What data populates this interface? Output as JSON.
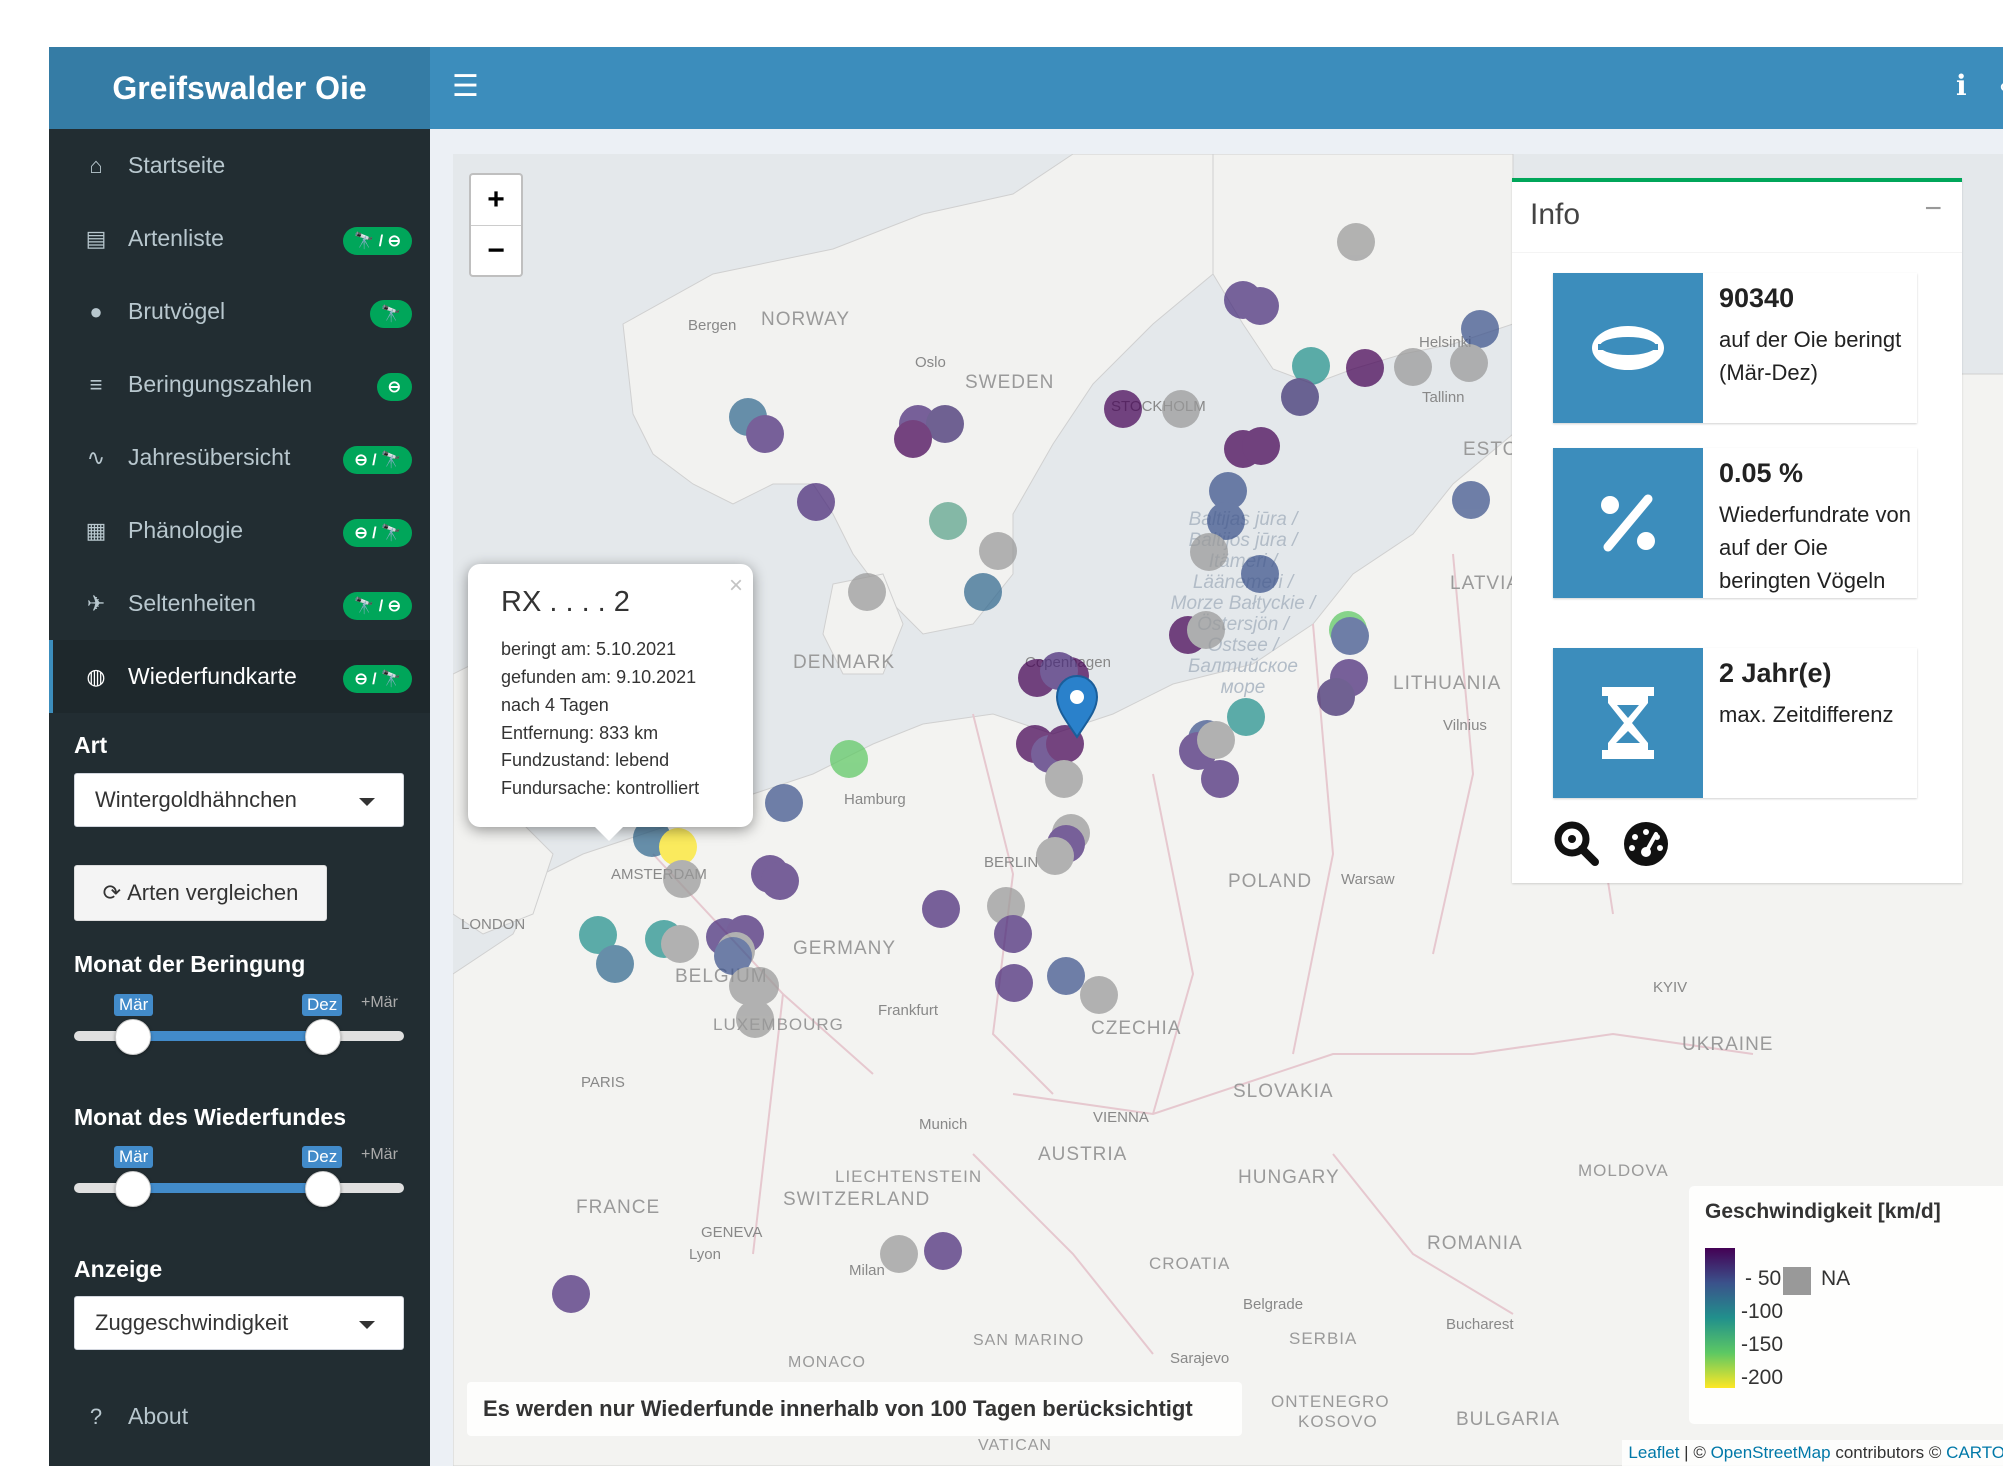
{
  "header": {
    "app_title": "Greifswalder Oie"
  },
  "sidebar": {
    "items": [
      {
        "label": "Startseite",
        "icon": "home-icon"
      },
      {
        "label": "Artenliste",
        "icon": "clipboard-icon",
        "badge": "🔭 / ⊖"
      },
      {
        "label": "Brutvögel",
        "icon": "egg-icon",
        "badge": "🔭"
      },
      {
        "label": "Beringungszahlen",
        "icon": "bar-chart-icon",
        "badge": "⊖"
      },
      {
        "label": "Jahresübersicht",
        "icon": "line-chart-icon",
        "badge": "⊖ / 🔭"
      },
      {
        "label": "Phänologie",
        "icon": "calendar-icon",
        "badge": "⊖ / 🔭"
      },
      {
        "label": "Seltenheiten",
        "icon": "bird-icon",
        "badge": "🔭 / ⊖"
      },
      {
        "label": "Wiederfundkarte",
        "icon": "globe-icon",
        "badge": "⊖ / 🔭",
        "active": true
      }
    ],
    "art_label": "Art",
    "art_value": "Wintergoldhähnchen",
    "compare_button": "Arten vergleichen",
    "ringing_month_label": "Monat der Beringung",
    "recovery_month_label": "Monat des Wiederfundes",
    "slider_from": "Mär",
    "slider_to": "Dez",
    "slider_extra": "+Mär",
    "display_label": "Anzeige",
    "display_value": "Zuggeschwindigkeit",
    "about_label": "About"
  },
  "popup": {
    "title": "RX . . . . 2",
    "close": "×",
    "lines": [
      "beringt am: 5.10.2021",
      "gefunden am: 9.10.2021",
      "nach 4 Tagen",
      "Entfernung: 833 km",
      "Fundzustand: lebend",
      "Fundursache: kontrolliert"
    ]
  },
  "info": {
    "title": "Info",
    "minimize": "−",
    "stats": [
      {
        "value": "90340",
        "text": "auf der Oie beringt (Mär-Dez)",
        "icon": "ring-icon"
      },
      {
        "value": "0.05 %",
        "text": "Wiederfundrate von auf der Oie beringten Vögeln",
        "icon": "percent-icon"
      },
      {
        "value": "2 Jahr(e)",
        "text": "max. Zeitdifferenz",
        "icon": "hourglass-icon"
      }
    ]
  },
  "notice": "Es werden nur Wiederfunde innerhalb von 100 Tagen berücksichtigt",
  "legend": {
    "title": "Geschwindigkeit [km/d]",
    "values": [
      "50",
      "100",
      "150",
      "200"
    ],
    "na_label": "NA"
  },
  "attribution": {
    "leaflet": "Leaflet",
    "sep": " | © ",
    "osm": "OpenStreetMap",
    "mid": " contributors © ",
    "carto": "CARTO"
  },
  "map_labels": {
    "norway": "NORWAY",
    "sweden": "SWEDEN",
    "denmark": "DENMARK",
    "germany": "GERMANY",
    "poland": "POLAND",
    "lithuania": "LITHUANIA",
    "latvia": "LATVIA",
    "esto": "ESTO",
    "belgium": "BELGIUM",
    "luxembourg": "LUXEMBOURG",
    "czechia": "CZECHIA",
    "slovakia": "SLOVAKIA",
    "austria": "AUSTRIA",
    "hungary": "HUNGARY",
    "france": "FRANCE",
    "switzerland": "SWITZERLAND",
    "liechtenstein": "LIECHTENSTEIN",
    "croatia": "CROATIA",
    "romania": "ROMANIA",
    "ukraine": "UKRAINE",
    "moldova": "MOLDOVA",
    "serbia": "SERBIA",
    "bulgaria": "BULGARIA",
    "kosovo": "KOSOVO",
    "montenegro": "ONTENEGRO",
    "san_marino": "SAN MARINO",
    "monaco": "MONACO",
    "vatican": "VATICAN",
    "bergen": "Bergen",
    "oslo": "Oslo",
    "stockholm": "STOCKHOLM",
    "helsinki": "Helsinki",
    "tallinn": "Tallinn",
    "copenhagen": "Copenhagen",
    "hamburg": "Hamburg",
    "berlin": "BERLIN",
    "amsterdam": "AMSTERDAM",
    "london": "LONDON",
    "paris": "PARIS",
    "frankfurt": "Frankfurt",
    "munich": "Munich",
    "vienna": "VIENNA",
    "warsaw": "Warsaw",
    "vilnius": "Vilnius",
    "kyiv": "KYIV",
    "geneva": "GENEVA",
    "lyon": "Lyon",
    "milan": "Milan",
    "belgrade": "Belgrade",
    "bucharest": "Bucharest",
    "sarajevo": "Sarajevo",
    "baltic_sea": "Baltijas jūra / Baltijos jūra / Itämeri / Läänemeri / Morze Bałtyckie / Östersjön / Ostsee / Балтийское море"
  },
  "colors": {
    "accent": "#3c8dbc",
    "brand": "#357ca5",
    "sidebar": "#222d32",
    "badge": "#00a65a"
  }
}
